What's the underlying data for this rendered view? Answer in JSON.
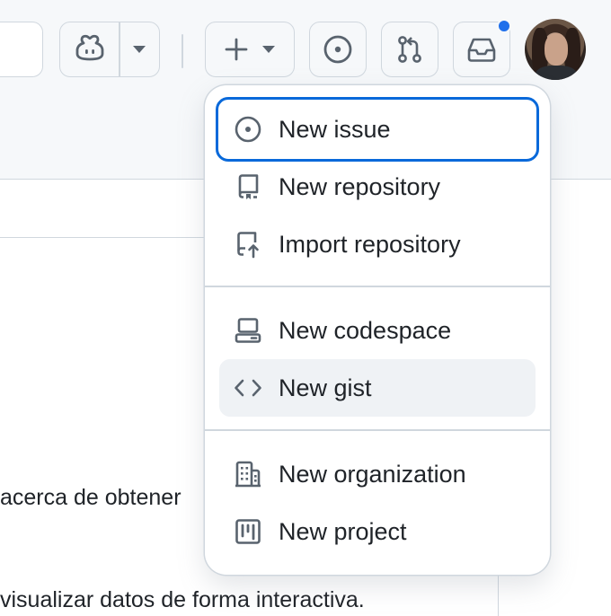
{
  "header": {
    "icons": {
      "copilot": "copilot-icon",
      "dropdown": "triangle-down-icon",
      "create": "plus-icon",
      "issues": "issue-opened-icon",
      "pulls": "git-pull-request-icon",
      "inbox": "inbox-icon"
    },
    "notification_dot_color": "#1f6feb"
  },
  "background_text": {
    "line1": "acerca de obtener",
    "line2": "visualizar datos de forma interactiva."
  },
  "menu": {
    "groups": [
      {
        "items": [
          {
            "label": "New issue",
            "icon": "issue-opened-icon",
            "state": "focused"
          },
          {
            "label": "New repository",
            "icon": "repo-icon"
          },
          {
            "label": "Import repository",
            "icon": "repo-push-icon"
          }
        ]
      },
      {
        "items": [
          {
            "label": "New codespace",
            "icon": "codespaces-icon"
          },
          {
            "label": "New gist",
            "icon": "code-icon",
            "state": "hover"
          }
        ]
      },
      {
        "items": [
          {
            "label": "New organization",
            "icon": "organization-icon"
          },
          {
            "label": "New project",
            "icon": "project-icon"
          }
        ]
      }
    ]
  },
  "colors": {
    "focus_ring": "#0969da",
    "hover_bg": "#eff2f5",
    "header_bg": "#f6f8fa",
    "border": "#d0d7de",
    "icon": "#59636e"
  }
}
